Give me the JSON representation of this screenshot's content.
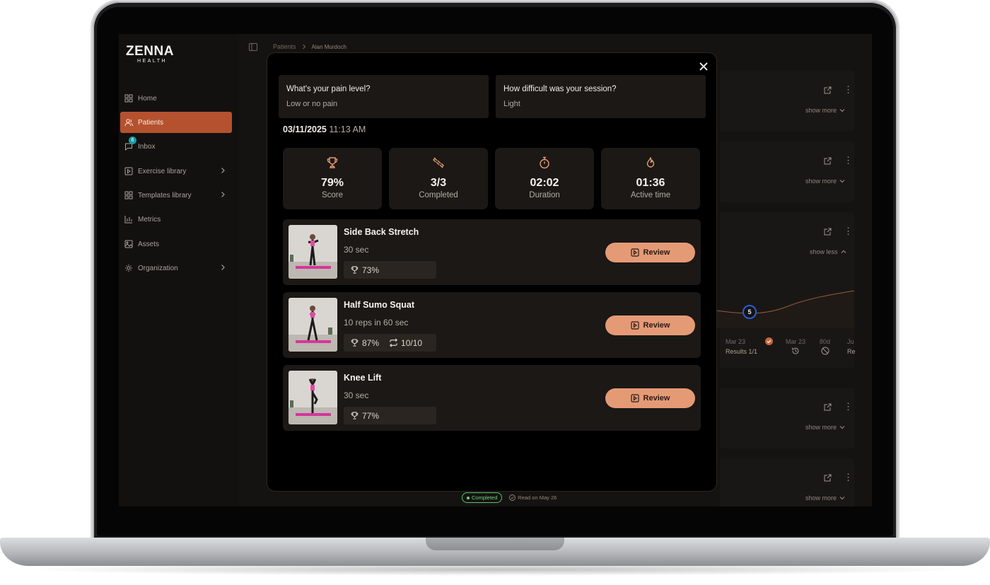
{
  "app": {
    "logo_main": "ZENNA",
    "logo_sub": "HEALTH"
  },
  "sidebar": {
    "items": [
      {
        "label": "Home",
        "icon": "grid-icon"
      },
      {
        "label": "Patients",
        "icon": "users-icon",
        "active": true
      },
      {
        "label": "Inbox",
        "icon": "chat-icon",
        "badge": "6"
      },
      {
        "label": "Exercise library",
        "icon": "play-square-icon",
        "has_submenu": true
      },
      {
        "label": "Templates library",
        "icon": "grid-icon",
        "has_submenu": true
      },
      {
        "label": "Metrics",
        "icon": "bar-chart-icon"
      },
      {
        "label": "Assets",
        "icon": "image-icon"
      },
      {
        "label": "Organization",
        "icon": "gear-icon",
        "has_submenu": true
      }
    ]
  },
  "breadcrumb": {
    "root": "Patients",
    "current": "Alan Murdoch"
  },
  "right_cards": {
    "show_more": "show more",
    "show_less": "show less"
  },
  "graph": {
    "node_value": "5",
    "label_a": "Mar 23",
    "label_b": "Mar 23",
    "label_c": "80d",
    "label_d": "Ju",
    "results": "Results 1/1",
    "results_cut": "Re"
  },
  "status": {
    "completed": "Completed",
    "read": "Read on May 26"
  },
  "modal": {
    "questions": [
      {
        "question": "What's your pain level?",
        "answer": "Low or no pain"
      },
      {
        "question": "How difficult was your session?",
        "answer": "Light"
      }
    ],
    "date": "03/11/2025",
    "time": "11:13 AM",
    "stats": [
      {
        "value": "79%",
        "label": "Score",
        "icon": "trophy-icon"
      },
      {
        "value": "3/3",
        "label": "Completed",
        "icon": "dumbbell-icon"
      },
      {
        "value": "02:02",
        "label": "Duration",
        "icon": "stopwatch-icon"
      },
      {
        "value": "01:36",
        "label": "Active time",
        "icon": "flame-icon"
      }
    ],
    "exercises": [
      {
        "title": "Side Back Stretch",
        "duration": "30 sec",
        "score": "73%",
        "reps": null
      },
      {
        "title": "Half Sumo Squat",
        "duration": "10 reps in 60 sec",
        "score": "87%",
        "reps": "10/10"
      },
      {
        "title": "Knee Lift",
        "duration": "30 sec",
        "score": "77%",
        "reps": null
      }
    ],
    "review_label": "Review"
  },
  "colors": {
    "accent": "#b4522f",
    "button": "#e59a76",
    "completed": "#56c26a"
  }
}
